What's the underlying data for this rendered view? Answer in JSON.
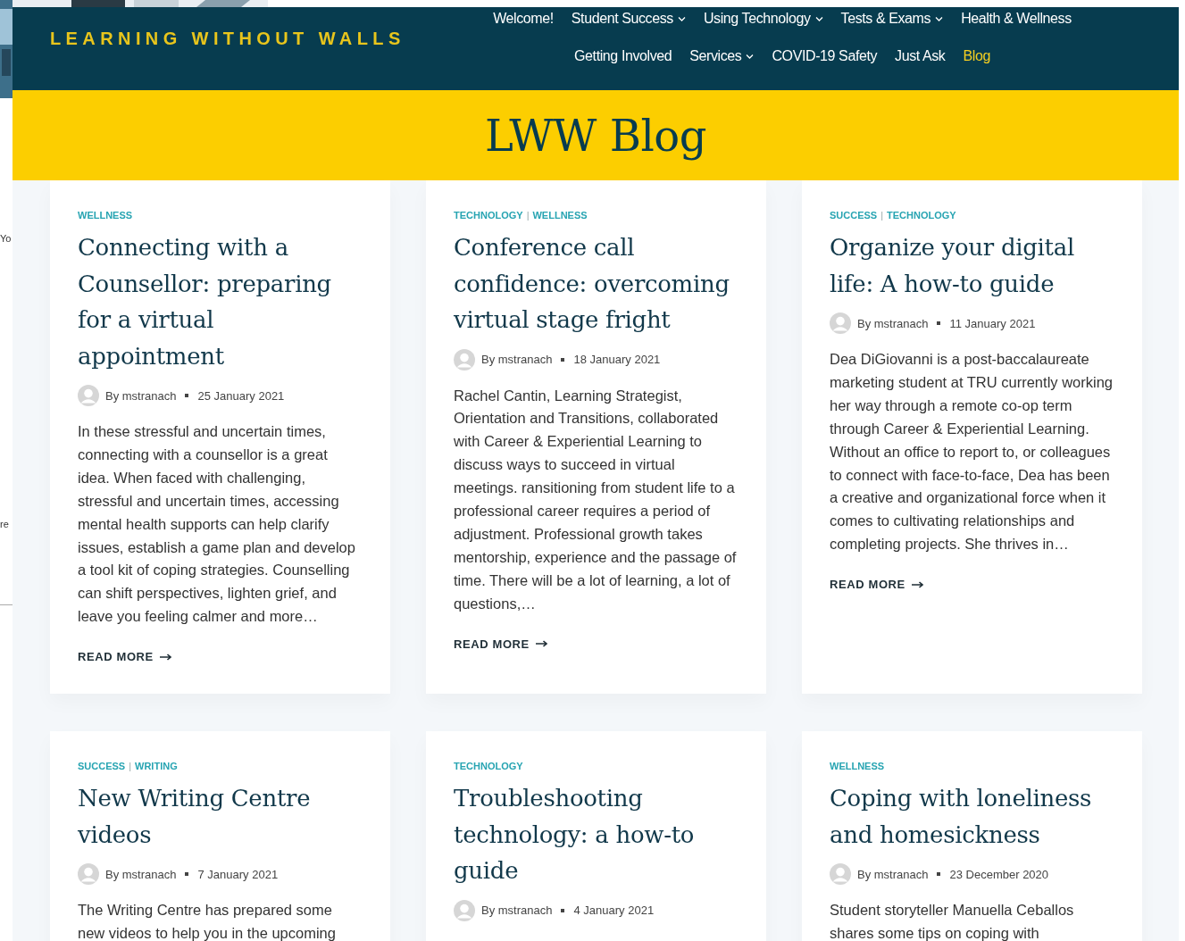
{
  "background_window": {
    "texts": [
      "Yo",
      "re"
    ]
  },
  "site": {
    "logo": "LEARNING WITHOUT WALLS"
  },
  "nav": {
    "rows": [
      {
        "items": [
          {
            "label": "Welcome!",
            "dropdown": false,
            "selected": false
          },
          {
            "label": "Student Success",
            "dropdown": true,
            "selected": false
          },
          {
            "label": "Using Technology",
            "dropdown": true,
            "selected": false
          },
          {
            "label": "Tests & Exams",
            "dropdown": true,
            "selected": false
          },
          {
            "label": "Health & Wellness",
            "dropdown": false,
            "selected": false
          }
        ]
      },
      {
        "items": [
          {
            "label": "Getting Involved",
            "dropdown": false,
            "selected": false
          },
          {
            "label": "Services",
            "dropdown": true,
            "selected": false
          },
          {
            "label": "COVID-19 Safety",
            "dropdown": false,
            "selected": false
          },
          {
            "label": "Just Ask",
            "dropdown": false,
            "selected": false
          },
          {
            "label": "Blog",
            "dropdown": false,
            "selected": true
          }
        ]
      }
    ]
  },
  "banner": {
    "title": "LWW Blog"
  },
  "category_separator": "|",
  "posts": [
    {
      "categories": [
        "WELLNESS"
      ],
      "title": "Connecting with a Counsellor: preparing for a virtual appointment",
      "author": "By mstranach",
      "date": "25 January 2021",
      "excerpt": "In these stressful and uncertain times, connecting with a counsellor is a great idea. When faced with challenging, stressful and uncertain times, accessing mental health supports can help clarify issues, establish a game plan and develop a tool kit of coping strategies. Counselling can shift perspectives, lighten grief, and leave you feeling calmer and more…",
      "read_more": "READ MORE"
    },
    {
      "categories": [
        "TECHNOLOGY",
        "WELLNESS"
      ],
      "title": "Conference call confidence: overcoming virtual stage fright",
      "author": "By mstranach",
      "date": "18 January 2021",
      "excerpt": "Rachel Cantin, Learning Strategist, Orientation and Transitions, collaborated with Career & Experiential Learning to discuss ways to succeed in virtual meetings. ransitioning from student life to a professional career requires a period of adjustment. Professional growth takes mentorship, experience and the passage of time. There will be a lot of learning, a lot of questions,…",
      "read_more": "READ MORE"
    },
    {
      "categories": [
        "SUCCESS",
        "TECHNOLOGY"
      ],
      "title": "Organize your digital life: A how-to guide",
      "author": "By mstranach",
      "date": "11 January 2021",
      "excerpt": "Dea DiGiovanni is a post-baccalaureate marketing student at TRU currently working her way through a remote co-op term through Career & Experiential Learning. Without an office to report to, or colleagues to connect with face-to-face, Dea has been a creative and organizational force when it comes to cultivating relationships and completing projects. She thrives in…",
      "read_more": "READ MORE"
    },
    {
      "categories": [
        "SUCCESS",
        "WRITING"
      ],
      "title": "New Writing Centre videos",
      "author": "By mstranach",
      "date": "7 January 2021",
      "excerpt": "The Writing Centre has prepared some new videos to help you in the upcoming"
    },
    {
      "categories": [
        "TECHNOLOGY"
      ],
      "title": "Troubleshooting technology: a how-to guide",
      "author": "By mstranach",
      "date": "4 January 2021"
    },
    {
      "categories": [
        "WELLNESS"
      ],
      "title": "Coping with loneliness and homesickness",
      "author": "By mstranach",
      "date": "23 December 2020",
      "excerpt": "Student storyteller Manuella Ceballos shares some tips on coping with"
    }
  ]
}
